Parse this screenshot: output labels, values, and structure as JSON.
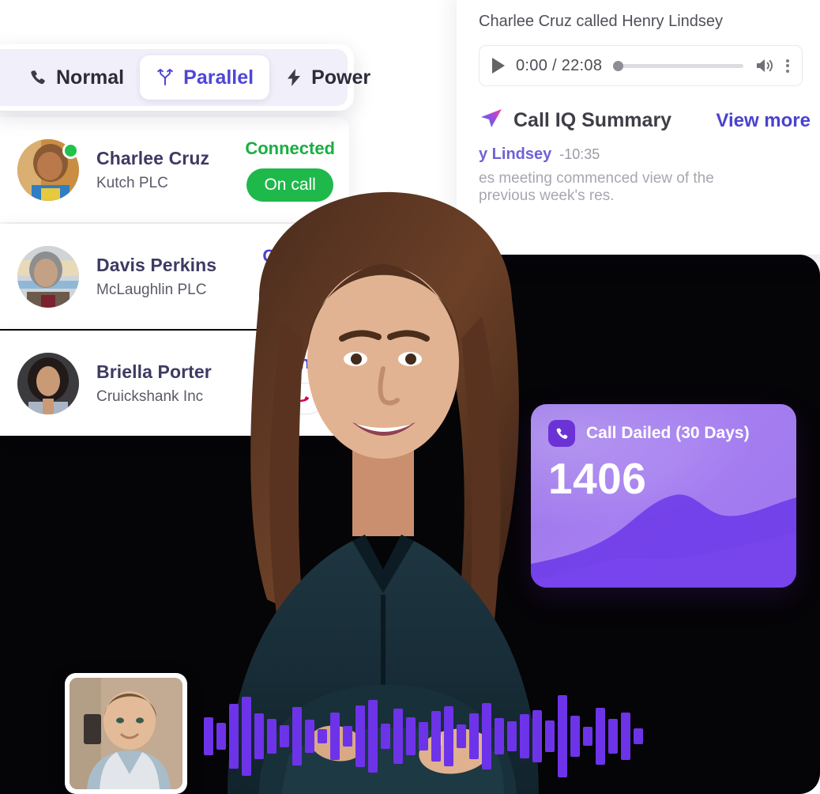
{
  "mode_toggle": {
    "segments": [
      {
        "label": "Normal",
        "icon": "phone-icon",
        "active": false
      },
      {
        "label": "Parallel",
        "icon": "branch-icon",
        "active": true
      },
      {
        "label": "Power",
        "icon": "bolt-icon",
        "active": false
      }
    ]
  },
  "contacts": [
    {
      "name": "Charlee Cruz",
      "org": "Kutch PLC",
      "status": "Connected",
      "action_label": "On call",
      "action_type": "oncall-badge",
      "presence": "online"
    },
    {
      "name": "Davis Perkins",
      "org": "McLaughlin PLC",
      "status": "Calling...",
      "action_label": "",
      "action_type": "hangup-button",
      "presence": "none"
    },
    {
      "name": "Briella Porter",
      "org": "Cruickshank Inc",
      "status": "Calling...",
      "action_label": "",
      "action_type": "hangup-button",
      "presence": "none"
    }
  ],
  "recording": {
    "title": "Charlee Cruz called Henry Lindsey",
    "time": "0:00 / 22:08",
    "current_time": "0:00",
    "duration": "22:08",
    "progress_percent": 0
  },
  "summary": {
    "title": "Call IQ Summary",
    "view_more": "View more",
    "speaker": "y Lindsey",
    "timestamp": "-10:35",
    "body": "es meeting commenced view of the previous week's res."
  },
  "stat_card": {
    "label": "Call Dailed (30 Days)",
    "value": "1406",
    "icon": "phone-icon",
    "accent": "#6b33d6"
  },
  "waveform": {
    "heights": [
      48,
      34,
      82,
      100,
      58,
      44,
      28,
      74,
      42,
      18,
      60,
      26,
      78,
      92,
      32,
      70,
      48,
      36,
      64,
      76,
      30,
      58,
      84,
      46,
      38,
      56,
      66,
      40,
      104,
      52,
      24,
      72,
      44,
      60,
      20
    ]
  },
  "colors": {
    "brand_purple": "#4b41cf",
    "wave_purple": "#6d33e8",
    "success_green": "#1fb84b",
    "status_green": "#18ae42",
    "hangup_red": "#d6004e",
    "card_lavender": "#f1eff9"
  }
}
